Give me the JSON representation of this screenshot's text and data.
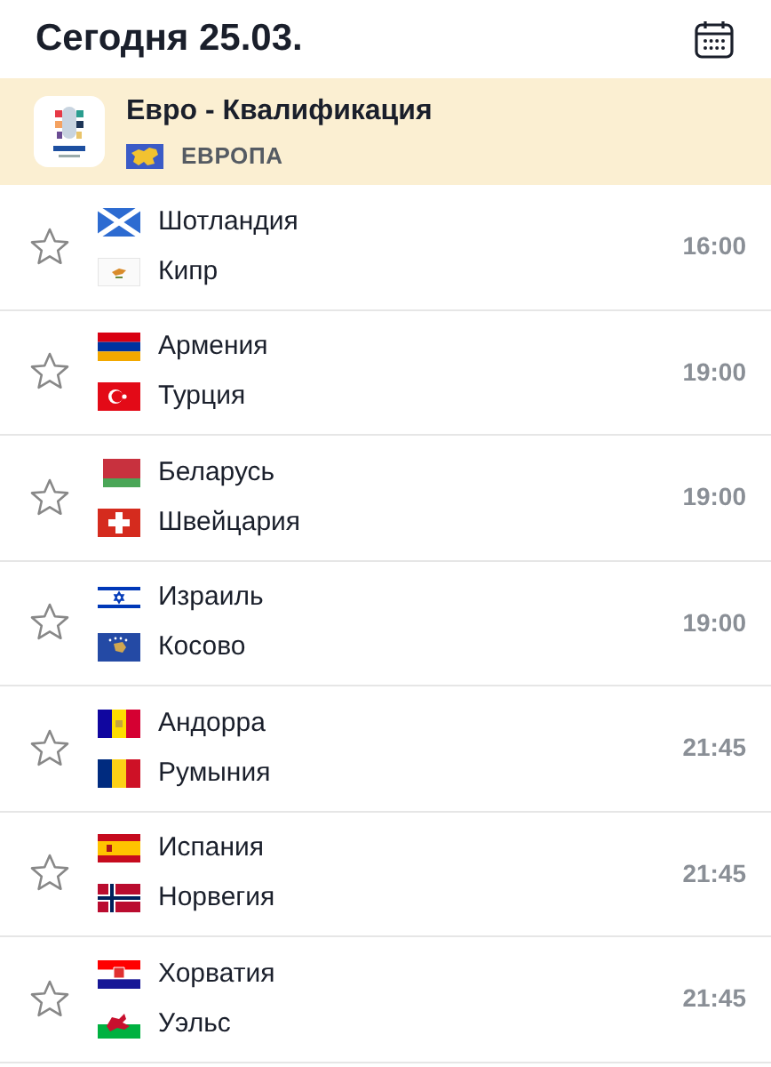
{
  "header": {
    "title": "Сегодня 25.03."
  },
  "league": {
    "name": "Евро - Квалификация",
    "region": "ЕВРОПА"
  },
  "matches": [
    {
      "home": "Шотландия",
      "away": "Кипр",
      "time": "16:00",
      "favorite": false
    },
    {
      "home": "Армения",
      "away": "Турция",
      "time": "19:00",
      "favorite": false
    },
    {
      "home": "Беларусь",
      "away": "Швейцария",
      "time": "19:00",
      "favorite": false
    },
    {
      "home": "Израиль",
      "away": "Косово",
      "time": "19:00",
      "favorite": false
    },
    {
      "home": "Андорра",
      "away": "Румыния",
      "time": "21:45",
      "favorite": false
    },
    {
      "home": "Испания",
      "away": "Норвегия",
      "time": "21:45",
      "favorite": false
    },
    {
      "home": "Хорватия",
      "away": "Уэльс",
      "time": "21:45",
      "favorite": false
    }
  ]
}
